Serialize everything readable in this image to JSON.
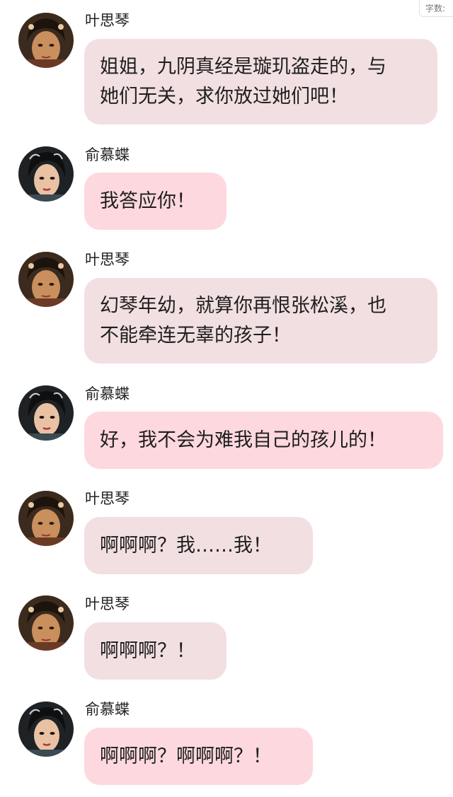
{
  "header": {
    "word_count_label": "字数:"
  },
  "colors": {
    "girl_bubble": "#f2dfe1",
    "lady_bubble": "#fdd8de"
  },
  "messages": [
    {
      "sender": "叶思琴",
      "avatar": "girl-avatar",
      "lines": [
        "姐姐，九阴真经是璇玑盗走的，与",
        "她们无关，求你放过她们吧！"
      ]
    },
    {
      "sender": "俞慕蝶",
      "avatar": "lady-avatar",
      "lines": [
        "我答应你！"
      ]
    },
    {
      "sender": "叶思琴",
      "avatar": "girl-avatar",
      "lines": [
        "幻琴年幼，就算你再恨张松溪，也",
        "不能牵连无辜的孩子！"
      ]
    },
    {
      "sender": "俞慕蝶",
      "avatar": "lady-avatar",
      "lines": [
        "好，我不会为难我自己的孩儿的！"
      ]
    },
    {
      "sender": "叶思琴",
      "avatar": "girl-avatar",
      "lines": [
        "啊啊啊？我……我！"
      ]
    },
    {
      "sender": "叶思琴",
      "avatar": "girl-avatar",
      "lines": [
        "啊啊啊？！"
      ]
    },
    {
      "sender": "俞慕蝶",
      "avatar": "lady-avatar",
      "lines": [
        "啊啊啊？啊啊啊？！"
      ]
    }
  ]
}
